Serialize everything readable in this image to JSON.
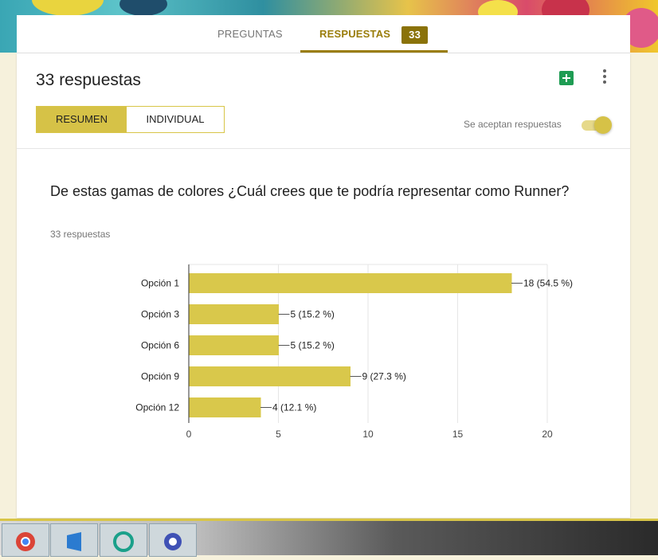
{
  "tabs": {
    "preguntas": "PREGUNTAS",
    "respuestas": "RESPUESTAS",
    "respuestas_badge": "33"
  },
  "header": {
    "title": "33 respuestas",
    "sheets_icon": "sheets-icon",
    "more_icon": "more-vert-icon"
  },
  "view_toggle": {
    "resumen": "RESUMEN",
    "individual": "INDIVIDUAL"
  },
  "accepting": {
    "label": "Se aceptan respuestas",
    "on": true
  },
  "question": {
    "text": "De estas gamas de colores ¿Cuál crees que te podría representar como Runner?",
    "count": "33 respuestas"
  },
  "colors": {
    "accent": "#9a7d0a",
    "bar": "#d9c84b",
    "badge": "#8a7209"
  },
  "chart_data": {
    "type": "bar",
    "orientation": "horizontal",
    "categories": [
      "Opción 1",
      "Opción 3",
      "Opción 6",
      "Opción 9",
      "Opción 12"
    ],
    "values": [
      18,
      5,
      5,
      9,
      4
    ],
    "data_labels": [
      "18 (54.5 %)",
      "5 (15.2 %)",
      "5 (15.2 %)",
      "9 (27.3 %)",
      "4 (12.1 %)"
    ],
    "xlim": [
      0,
      20
    ],
    "xticks": [
      0,
      5,
      10,
      15,
      20
    ],
    "grid": true,
    "title": "",
    "xlabel": "",
    "ylabel": ""
  }
}
